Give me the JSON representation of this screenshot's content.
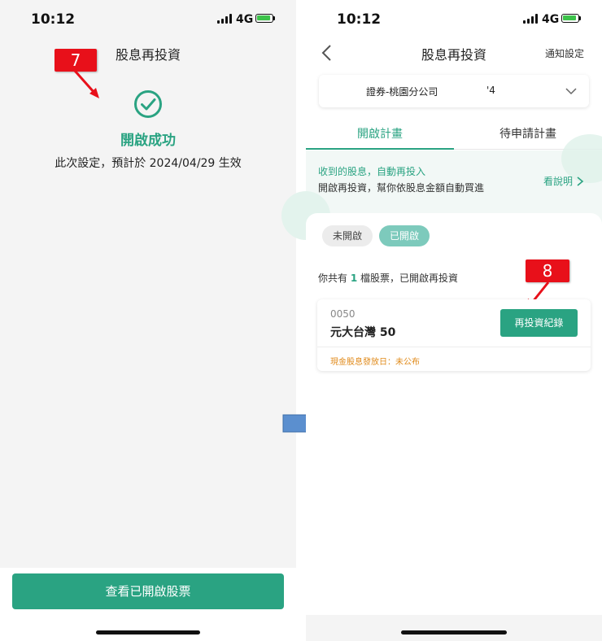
{
  "left_screen": {
    "status_bar": {
      "time": "10:12",
      "network": "4G"
    },
    "title": "股息再投資",
    "step_badge": "7",
    "success_icon": "check-circle-icon",
    "success_text": "開啟成功",
    "effect_text": "此次設定，預計於 2024/04/29 生效",
    "primary_button": "查看已開啟股票"
  },
  "right_screen": {
    "status_bar": {
      "time": "10:12",
      "network": "4G"
    },
    "title": "股息再投資",
    "back_icon": "chevron-left-icon",
    "nav_action": "通知設定",
    "account": {
      "branch": "證券-桃園分公司",
      "suffix": "'4"
    },
    "tabs": [
      {
        "label": "開啟計畫",
        "active": true
      },
      {
        "label": "待申請計畫",
        "active": false
      }
    ],
    "promo": {
      "line1": "收到的股息，自動再投入",
      "line2": "開啟再投資，幫你依股息金額自動買進",
      "link": "看說明",
      "link_icon": "chevron-right-icon"
    },
    "filters": [
      "未開啟",
      "已開啟"
    ],
    "active_filter": "已開啟",
    "summary": {
      "prefix": "你共有 ",
      "count": "1",
      "suffix": " 檔股票，已開啟再投資"
    },
    "step_badge": "8",
    "stock": {
      "code": "0050",
      "name": "元大台灣 50",
      "button": "再投資紀錄",
      "dividend_date": "現金股息發放日：未公布"
    }
  },
  "colors": {
    "accent": "#2aa382",
    "badge": "#e8101a",
    "arrow": "#5b8fcf",
    "warn": "#e08a1a"
  }
}
